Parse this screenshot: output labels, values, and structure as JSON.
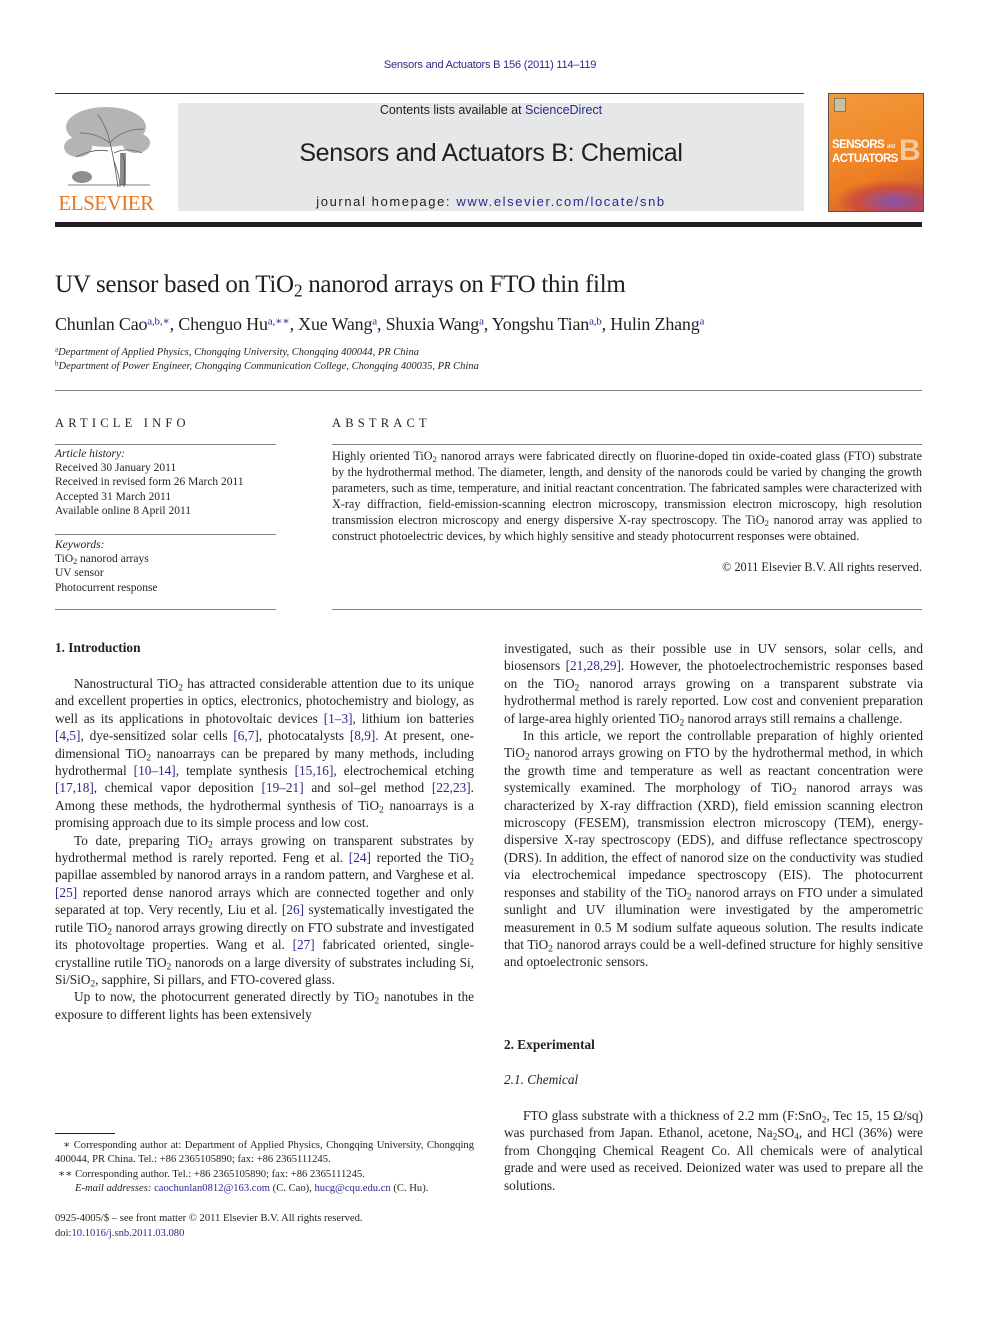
{
  "running_header": "Sensors and Actuators B 156 (2011) 114–119",
  "masthead": {
    "publisher_name": "ELSEVIER",
    "contents_prefix": "Contents lists available at ",
    "contents_link": "ScienceDirect",
    "journal_title": "Sensors and Actuators B: Chemical",
    "homepage_prefix": "journal homepage: ",
    "homepage_link": "www.elsevier.com/locate/snb",
    "cover": {
      "line1": "SENSORS",
      "line1_small": "and",
      "line2": "ACTUATORS",
      "letter": "B"
    },
    "colors": {
      "publisher_orange": "#e87722",
      "link_blue": "#2a2a8c",
      "masthead_gray": "#e6e7e8",
      "cover_orange": "#f08a2a"
    }
  },
  "article": {
    "title_pre": "UV sensor based on TiO",
    "title_sub": "2",
    "title_post": " nanorod arrays on FTO thin film",
    "authors": [
      {
        "name": "Chunlan Cao",
        "marks": "a,b,∗",
        "sep": ", "
      },
      {
        "name": "Chenguo Hu",
        "marks": "a,∗∗",
        "sep": ", "
      },
      {
        "name": "Xue Wang",
        "marks": "a",
        "sep": ", "
      },
      {
        "name": "Shuxia Wang",
        "marks": "a",
        "sep": ", "
      },
      {
        "name": "Yongshu Tian",
        "marks": "a,b",
        "sep": ", "
      },
      {
        "name": "Hulin Zhang",
        "marks": "a",
        "sep": ""
      }
    ],
    "affiliations": [
      {
        "mark": "a",
        "text": "Department of Applied Physics, Chongqing University, Chongqing 400044, PR China"
      },
      {
        "mark": "b",
        "text": "Department of Power Engineer, Chongqing Communication College, Chongqing 400035, PR China"
      }
    ]
  },
  "article_info": {
    "heading": "ARTICLE INFO",
    "history_label": "Article history:",
    "history": [
      "Received 30 January 2011",
      "Received in revised form 26 March 2011",
      "Accepted 31 March 2011",
      "Available online 8 April 2011"
    ],
    "keywords_label": "Keywords:",
    "keyword_1_pre": "TiO",
    "keyword_1_sub": "2",
    "keyword_1_post": " nanorod arrays",
    "keyword_2": "UV sensor",
    "keyword_3": "Photocurrent response"
  },
  "abstract": {
    "heading": "ABSTRACT",
    "t1": "Highly oriented TiO",
    "t2": " nanorod arrays were fabricated directly on fluorine-doped tin oxide-coated glass (FTO) substrate by the hydrothermal method. The diameter, length, and density of the nanorods could be varied by changing the growth parameters, such as time, temperature, and initial reactant concentration. The fabricated samples were characterized with X-ray diffraction, field-emission-scanning electron microscopy, transmission electron microscopy, high resolution transmission electron microscopy and energy dispersive X-ray spectroscopy. The TiO",
    "t3": " nanorod array was applied to construct photoelectric devices, by which highly sensitive and steady photocurrent responses were obtained.",
    "sub": "2",
    "copyright": "© 2011 Elsevier B.V. All rights reserved."
  },
  "introduction": {
    "heading": "1.  Introduction",
    "p1": {
      "a": "Nanostructural TiO",
      "b": " has attracted considerable attention due to its unique and excellent properties in optics, electronics, photochemistry and biology, as well as its applications in photovoltaic devices ",
      "r1": "[1–3]",
      "c": ", lithium ion batteries ",
      "r2": "[4,5]",
      "d": ", dye-sensitized solar cells ",
      "r3": "[6,7]",
      "e": ", photocatalysts ",
      "r4": "[8,9]",
      "f": ". At present, one-dimensional TiO",
      "g": " nanoarrays can be prepared by many methods, including hydrothermal ",
      "r5": "[10–14]",
      "h": ", template synthesis ",
      "r6": "[15,16]",
      "i": ", electrochemical etching ",
      "r7": "[17,18]",
      "j": ", chemical vapor deposition ",
      "r8": "[19–21]",
      "k": " and sol–gel method ",
      "r9": "[22,23]",
      "l": ". Among these methods, the hydrothermal synthesis of TiO",
      "m": " nanoarrays is a promising approach due to its simple process and low cost."
    },
    "p2": {
      "a": "To date, preparing TiO",
      "b": " arrays growing on transparent substrates by hydrothermal method is rarely reported. Feng et al. ",
      "r1": "[24]",
      "c": " reported the TiO",
      "d": " papillae assembled by nanorod arrays in a random pattern, and Varghese et al. ",
      "r2": "[25]",
      "e": " reported dense nanorod arrays which are connected together and only separated at top. Very recently, Liu et al. ",
      "r3": "[26]",
      "f": " systematically investigated the rutile TiO",
      "g": " nanorod arrays growing directly on FTO substrate and investigated its photovoltage properties. Wang et al. ",
      "r4": "[27]",
      "h": " fabricated oriented, single-crystalline rutile TiO",
      "i": " nanorods on a large diversity of substrates including Si, Si/SiO",
      "j": ", sapphire, Si pillars, and FTO-covered glass."
    },
    "p3": {
      "a": "Up to now, the photocurrent generated directly by TiO",
      "b": " nanotubes in the exposure to different lights has been extensively investigated, such as their possible use in UV sensors, solar cells, and biosensors ",
      "r1": "[21,28,29]",
      "c": ". However, the photoelectrochemistric responses based on the TiO",
      "d": " nanorod arrays growing on a transparent substrate via hydrothermal method is rarely reported. Low cost and convenient preparation of large-area highly oriented TiO",
      "e": " nanorod arrays still remains a challenge."
    },
    "p4": {
      "a": "In this article, we report the controllable preparation of highly oriented TiO",
      "b": " nanorod arrays growing on FTO by the hydrothermal method, in which the growth time and temperature as well as reactant concentration were systemically examined. The morphology of TiO",
      "c": " nanorod arrays was characterized by X-ray diffraction (XRD), field emission scanning electron microscopy (FESEM), transmission electron microscopy (TEM), energy-dispersive X-ray spectroscopy (EDS), and diffuse reflectance spectroscopy (DRS). In addition, the effect of nanorod size on the conductivity was studied via electrochemical impedance spectroscopy (EIS). The photocurrent responses and stability of the TiO",
      "d": " nanorod arrays on FTO under a simulated sunlight and UV illumination were investigated by the amperometric measurement in 0.5 M sodium sulfate aqueous solution. The results indicate that TiO",
      "e": " nanorod arrays could be a well-defined structure for highly sensitive and optoelectronic sensors."
    },
    "sub": "2"
  },
  "experimental": {
    "heading": "2.  Experimental",
    "subheading": "2.1.  Chemical",
    "p1": {
      "a": "FTO glass substrate with a thickness of 2.2 mm (F:SnO",
      "b": ", Tec 15, 15 Ω/sq) was purchased from Japan. Ethanol, acetone, Na",
      "c": "SO",
      "d": ", and HCl (36%) were from Chongqing Chemical Reagent Co. All chemicals were of analytical grade and were used as received. Deionized water was used to prepare all the solutions.",
      "sub2": "2",
      "sub4": "4"
    }
  },
  "footnotes": {
    "fn1_mark": "∗",
    "fn1": "Corresponding author at: Department of Applied Physics, Chongqing University, Chongqing 400044, PR China. Tel.: +86 2365105890; fax: +86 2365111245.",
    "fn2_mark": "∗∗",
    "fn2": "Corresponding author. Tel.: +86 2365105890; fax: +86 2365111245.",
    "email_label": "E-mail addresses:",
    "email_1": "caochunlan0812@163.com",
    "email_1_who": " (C. Cao), ",
    "email_2": "hucg@cqu.edu.cn",
    "email_2_who": " (C. Hu).",
    "front_matter": "0925-4005/$ – see front matter © 2011 Elsevier B.V. All rights reserved.",
    "doi_label": "doi:",
    "doi": "10.1016/j.snb.2011.03.080"
  }
}
